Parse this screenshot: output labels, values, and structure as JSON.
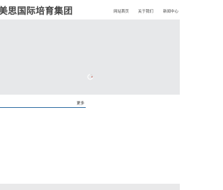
{
  "header": {
    "logo_text": "美思国际培育集团",
    "nav": [
      {
        "label": "网站首页"
      },
      {
        "label": "关于我们"
      },
      {
        "label": "新闻中心"
      }
    ]
  },
  "banner": {
    "loading_icon": "spinner-icon"
  },
  "section": {
    "more_label": "更多",
    "accent_color": "#2a6aa1"
  },
  "colors": {
    "banner_bg": "#e7e8ea",
    "footer_bg": "#e9e9ea"
  }
}
